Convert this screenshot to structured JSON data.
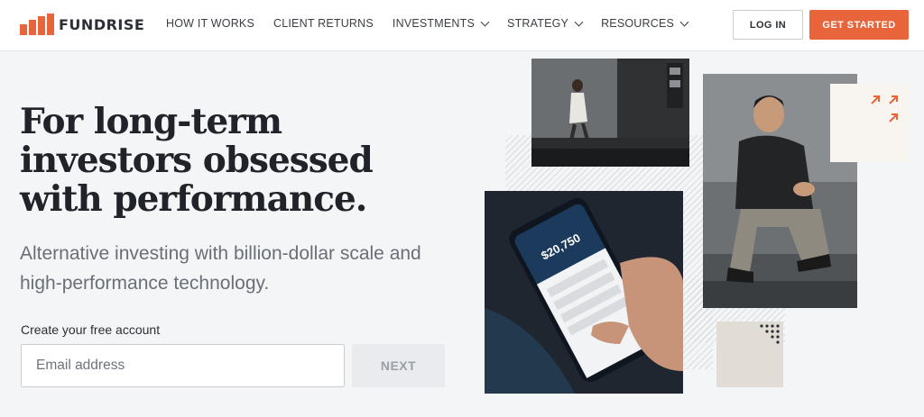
{
  "brand": {
    "name": "FUNDRISE",
    "accent": "#e8643a"
  },
  "nav": {
    "items": [
      {
        "label": "HOW IT WORKS",
        "dropdown": false
      },
      {
        "label": "CLIENT RETURNS",
        "dropdown": false
      },
      {
        "label": "INVESTMENTS",
        "dropdown": true
      },
      {
        "label": "STRATEGY",
        "dropdown": true
      },
      {
        "label": "RESOURCES",
        "dropdown": true
      }
    ],
    "login_label": "LOG IN",
    "cta_label": "GET STARTED"
  },
  "hero": {
    "headline": "For long-term investors obsessed with performance.",
    "subhead": "Alternative investing with billion-dollar scale and high-performance technology.",
    "form_label": "Create your free account",
    "email_placeholder": "Email address",
    "next_label": "NEXT"
  },
  "collage": {
    "phone_amount": "$20,750",
    "icons": [
      "expand-arrows-icon",
      "dots-grid-icon"
    ]
  }
}
